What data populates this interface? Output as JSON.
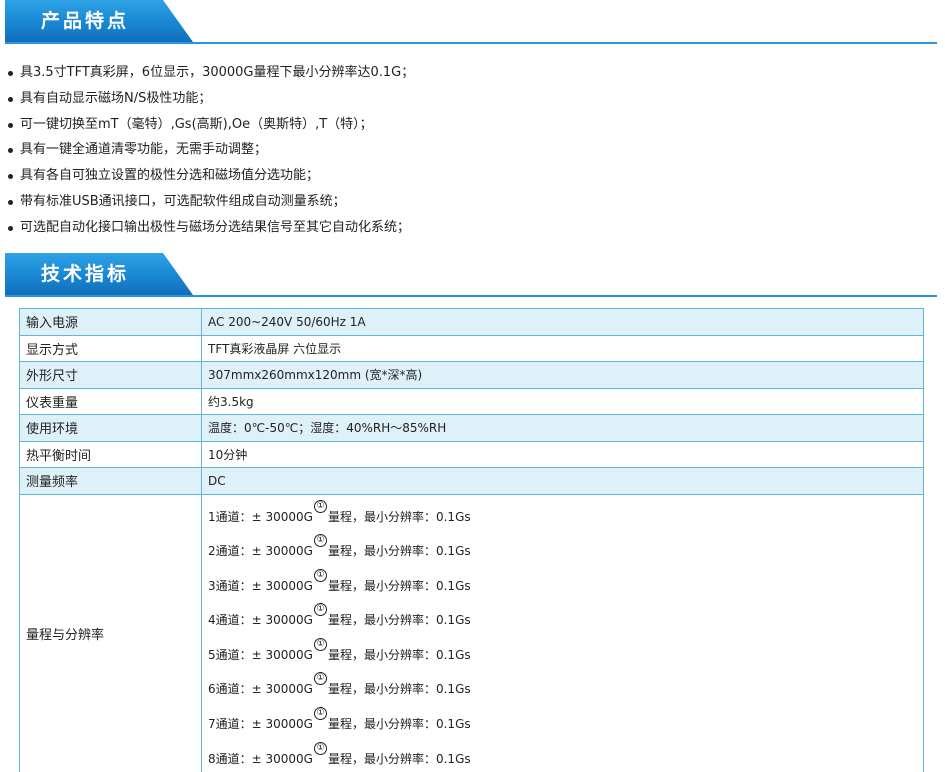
{
  "sections": {
    "features_title": "产品特点",
    "specs_title": "技术指标"
  },
  "features": [
    "具3.5寸TFT真彩屏，6位显示，30000G量程下最小分辨率达0.1G；",
    "具有自动显示磁场N/S极性功能；",
    "可一键切换至mT（毫特）,Gs(高斯),Oe（奥斯特）,T（特）；",
    "具有一键全通道清零功能，无需手动调整；",
    "具有各自可独立设置的极性分选和磁场值分选功能；",
    "带有标准USB通讯接口，可选配软件组成自动测量系统；",
    "可选配自动化接口输出极性与磁场分选结果信号至其它自动化系统；"
  ],
  "specs": [
    {
      "label": "输入电源",
      "value": "AC 200~240V  50/60Hz  1A"
    },
    {
      "label": "显示方式",
      "value": "TFT真彩液晶屏      六位显示"
    },
    {
      "label": "外形尺寸",
      "value": "307mmx260mmx120mm (宽*深*高)"
    },
    {
      "label": "仪表重量",
      "value": "约3.5kg"
    },
    {
      "label": "使用环境",
      "value": "温度：0℃-50℃；湿度：40%RH～85%RH"
    },
    {
      "label": "热平衡时间",
      "value": "10分钟"
    },
    {
      "label": "测量频率",
      "value": "DC"
    }
  ],
  "ranges": {
    "label": "量程与分辨率",
    "circle_mark": "①",
    "channels": [
      {
        "prefix": "1通道：± 30000G",
        "suffix": "量程，最小分辨率：0.1Gs"
      },
      {
        "prefix": "2通道：± 30000G",
        "suffix": "量程，最小分辨率：0.1Gs"
      },
      {
        "prefix": "3通道：± 30000G",
        "suffix": "量程，最小分辨率：0.1Gs"
      },
      {
        "prefix": "4通道：± 30000G",
        "suffix": "量程，最小分辨率：0.1Gs"
      },
      {
        "prefix": "5通道：± 30000G",
        "suffix": "量程，最小分辨率：0.1Gs"
      },
      {
        "prefix": "6通道：± 30000G",
        "suffix": "量程，最小分辨率：0.1Gs"
      },
      {
        "prefix": "7通道：± 30000G",
        "suffix": "量程，最小分辨率：0.1Gs"
      },
      {
        "prefix": "8通道：± 30000G",
        "suffix": "量程，最小分辨率：0.1Gs"
      }
    ]
  },
  "colors": {
    "banner_blue": "#1a86d2",
    "row_tint": "#dff1f8",
    "table_border": "#5fb8d8"
  }
}
